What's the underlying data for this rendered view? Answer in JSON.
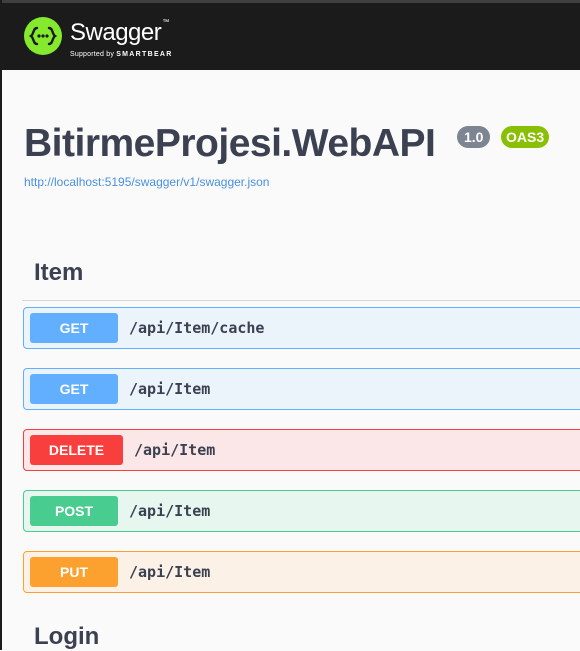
{
  "header": {
    "logo_name": "Swagger",
    "logo_tm": "™",
    "supported_by": "Supported by",
    "smartbear": "SMARTBEAR",
    "logo_icon": "swagger-braces-icon",
    "brand_color": "#85ea2d"
  },
  "info": {
    "title": "BitirmeProjesi.WebAPI",
    "version": "1.0",
    "oas": "OAS3",
    "url": "http://localhost:5195/swagger/v1/swagger.json"
  },
  "tags": [
    {
      "name": "Item",
      "operations": [
        {
          "method": "GET",
          "path": "/api/Item/cache",
          "color": "#61affe"
        },
        {
          "method": "GET",
          "path": "/api/Item",
          "color": "#61affe"
        },
        {
          "method": "DELETE",
          "path": "/api/Item",
          "color": "#f93e3e"
        },
        {
          "method": "POST",
          "path": "/api/Item",
          "color": "#49cc90"
        },
        {
          "method": "PUT",
          "path": "/api/Item",
          "color": "#fca130"
        }
      ]
    },
    {
      "name": "Login",
      "operations": []
    }
  ]
}
